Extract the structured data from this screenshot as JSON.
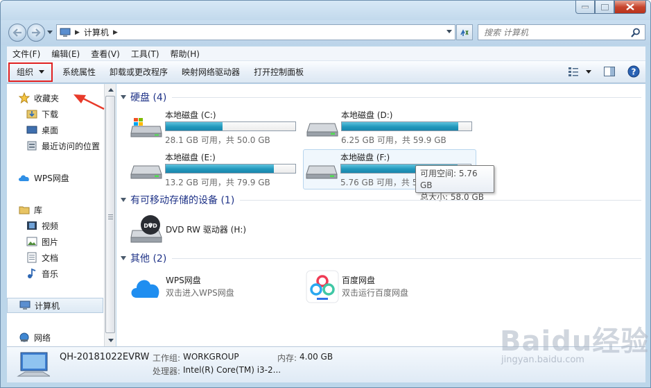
{
  "window": {
    "address_segment": "计算机",
    "search_placeholder": "搜索 计算机"
  },
  "menu": [
    "文件(F)",
    "编辑(E)",
    "查看(V)",
    "工具(T)",
    "帮助(H)"
  ],
  "toolbar": {
    "organize": "组织",
    "items": [
      "系统属性",
      "卸载或更改程序",
      "映射网络驱动器",
      "打开控制面板"
    ]
  },
  "nav": {
    "favorites": "收藏夹",
    "downloads": "下载",
    "desktop": "桌面",
    "recent": "最近访问的位置",
    "wps": "WPS网盘",
    "libraries": "库",
    "videos": "视频",
    "pictures": "图片",
    "documents": "文档",
    "music": "音乐",
    "computer": "计算机",
    "network": "网络"
  },
  "groups": {
    "hard_disks": "硬盘 (4)",
    "removable": "有可移动存储的设备 (1)",
    "other": "其他 (2)"
  },
  "drives": [
    {
      "name": "本地磁盘 (C:)",
      "info": "28.1 GB 可用，共 50.0 GB",
      "used_fraction": 0.438
    },
    {
      "name": "本地磁盘 (D:)",
      "info": "6.25 GB 可用，共 59.9 GB",
      "used_fraction": 0.896
    },
    {
      "name": "本地磁盘 (E:)",
      "info": "13.2 GB 可用，共 79.9 GB",
      "used_fraction": 0.835
    },
    {
      "name": "本地磁盘 (F:)",
      "info": "5.76 GB 可用，共 5",
      "used_fraction": 0.901
    }
  ],
  "tooltip": {
    "free": "可用空间: 5.76 GB",
    "total": "总大小: 58.0 GB"
  },
  "dvd": {
    "name": "DVD RW 驱动器 (H:)",
    "badge": "DVD"
  },
  "others": [
    {
      "name": "WPS网盘",
      "desc": "双击进入WPS网盘"
    },
    {
      "name": "百度网盘",
      "desc": "双击运行百度网盘"
    }
  ],
  "details": {
    "computer_name": "QH-20181022EVRW",
    "workgroup_label": "工作组:",
    "workgroup_value": "WORKGROUP",
    "memory_label": "内存:",
    "memory_value": "4.00 GB",
    "cpu_label": "处理器:",
    "cpu_value": "Intel(R) Core(TM) i3-2..."
  },
  "watermark": {
    "text": "Baidu经验",
    "url": "jingyan.baidu.com"
  },
  "colors": {
    "accent": "#1e3287",
    "bar_fill": "#2298bc",
    "highlight_box": "#e02020"
  }
}
